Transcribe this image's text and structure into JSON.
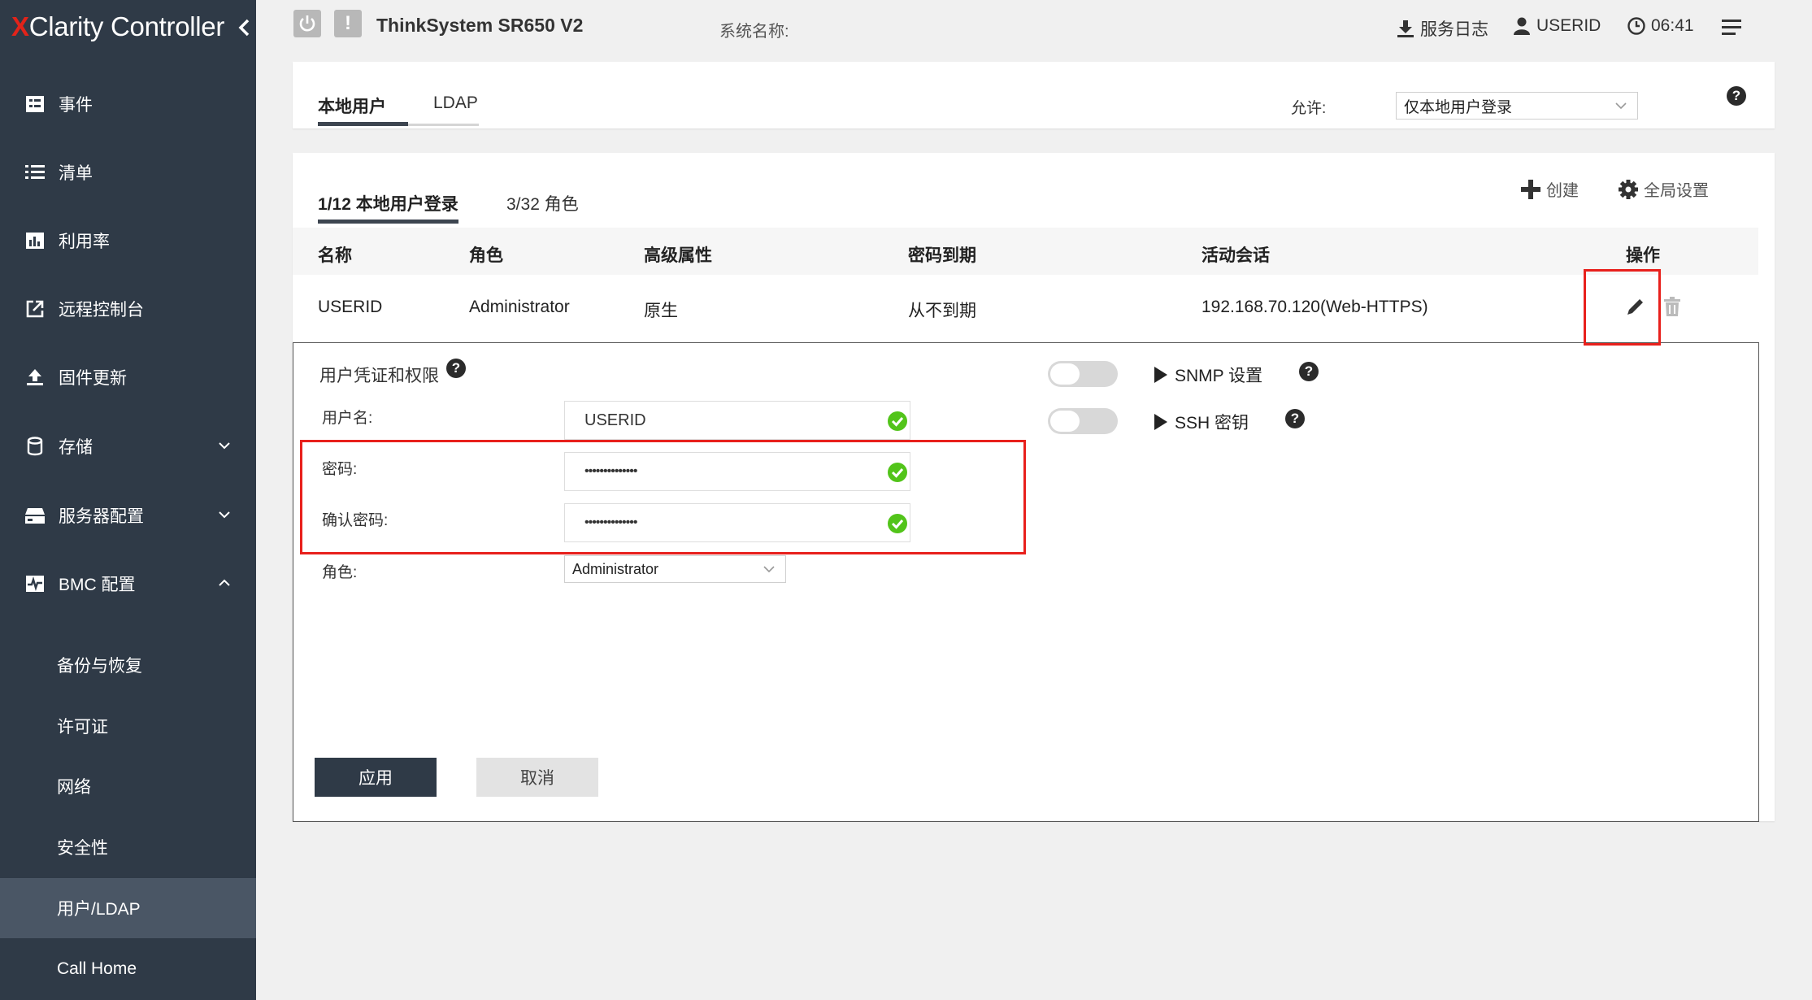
{
  "brand": {
    "prefix": "X",
    "rest": "Clarity",
    "suffix": " Controller"
  },
  "sidebar": {
    "items": [
      {
        "label": "事件"
      },
      {
        "label": "清单"
      },
      {
        "label": "利用率"
      },
      {
        "label": "远程控制台"
      },
      {
        "label": "固件更新"
      },
      {
        "label": "存储"
      },
      {
        "label": "服务器配置"
      },
      {
        "label": "BMC 配置"
      }
    ],
    "subitems": [
      {
        "label": "备份与恢复"
      },
      {
        "label": "许可证"
      },
      {
        "label": "网络"
      },
      {
        "label": "安全性"
      },
      {
        "label": "用户/LDAP"
      },
      {
        "label": "Call Home"
      }
    ],
    "active_subitem": "用户/LDAP"
  },
  "topbar": {
    "warning_symbol": "!",
    "system_title": "ThinkSystem SR650 V2",
    "system_name_label": "系统名称:",
    "service_log": "服务日志",
    "user": "USERID",
    "time": "06:41"
  },
  "tabs": {
    "local_user": "本地用户",
    "ldap": "LDAP",
    "allow_label": "允许:",
    "allow_value": "仅本地用户登录"
  },
  "subtabs": {
    "local_logins": "1/12 本地用户登录",
    "roles": "3/32 角色",
    "create": "创建",
    "global_settings": "全局设置"
  },
  "table": {
    "headers": [
      "名称",
      "角色",
      "高级属性",
      "密码到期",
      "活动会话",
      "操作"
    ],
    "rows": [
      {
        "name": "USERID",
        "role": "Administrator",
        "advanced": "原生",
        "expiry": "从不到期",
        "session": "192.168.70.120(Web-HTTPS)"
      }
    ]
  },
  "detail": {
    "section_title": "用户凭证和权限",
    "username_label": "用户名:",
    "username_value": "USERID",
    "password_label": "密码:",
    "password_value": "••••••••••••••",
    "confirm_label": "确认密码:",
    "confirm_value": "••••••••••••••",
    "role_label": "角色:",
    "role_value": "Administrator",
    "snmp_label": "SNMP 设置",
    "ssh_label": "SSH 密钥",
    "apply": "应用",
    "cancel": "取消"
  },
  "colors": {
    "sidebar_bg": "#2f3a47",
    "accent_red": "#e8201c",
    "check_green": "#52c41a",
    "brand_red": "#e2231a"
  }
}
